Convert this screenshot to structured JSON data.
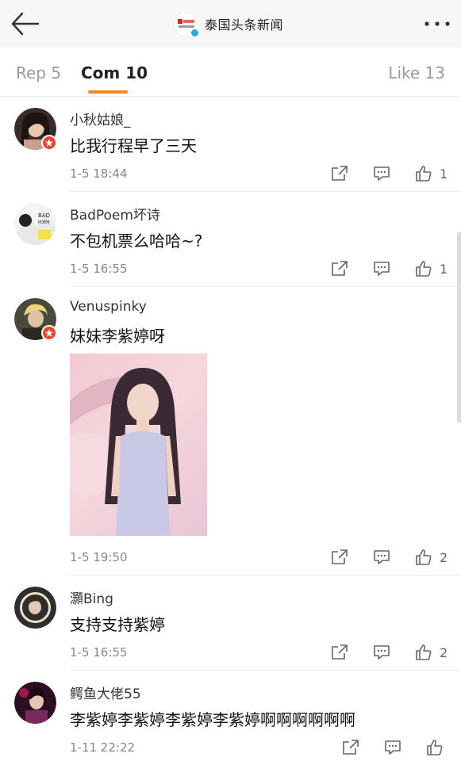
{
  "header": {
    "title": "泰国头条新闻",
    "back_icon": "arrow-left-icon",
    "more_icon": "more-dots-icon"
  },
  "tabs": [
    {
      "label": "Rep 5"
    },
    {
      "label": "Com 10"
    },
    {
      "label": "Like 13"
    }
  ],
  "accent_color": "#f08a1c",
  "comments": [
    {
      "user": "小秋姑娘_",
      "text": "比我行程早了三天",
      "time": "1-5 18:44",
      "likes": "1"
    },
    {
      "user": "BadPoem坏诗",
      "text": "不包机票么哈哈~?",
      "time": "1-5 16:55",
      "likes": "1"
    },
    {
      "user": "Venuspinky",
      "text": "妹妹李紫婷呀",
      "time": "1-5 19:50",
      "likes": "2"
    },
    {
      "user": "灝Bing",
      "text": "支持支持紫婷",
      "time": "1-5 16:55",
      "likes": "2"
    },
    {
      "user": "鳄鱼大佬55",
      "text": "李紫婷李紫婷李紫婷李紫婷啊啊啊啊啊啊",
      "time": "1-11 22:22",
      "likes": ""
    }
  ]
}
